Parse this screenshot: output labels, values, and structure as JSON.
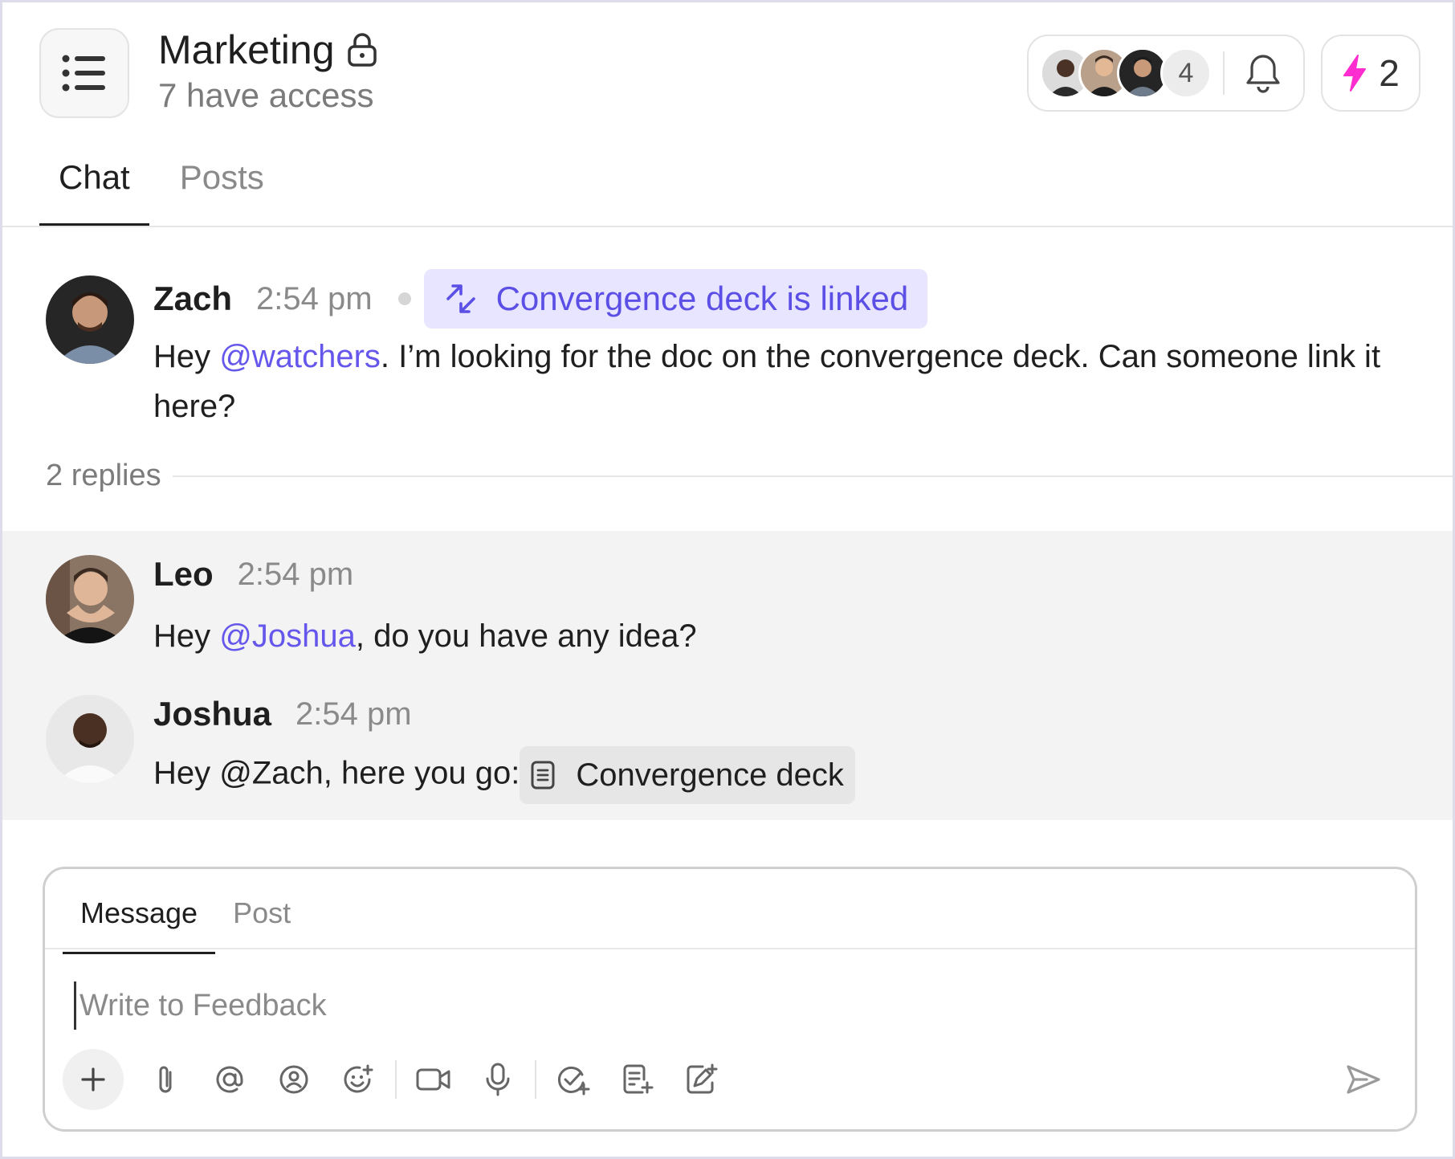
{
  "channel": {
    "title": "Marketing",
    "access_text": "7 have access"
  },
  "header": {
    "watchers_extra_count": "4",
    "boost_count": "2"
  },
  "tabs": [
    {
      "label": "Chat",
      "active": true
    },
    {
      "label": "Posts",
      "active": false
    }
  ],
  "messages": {
    "root": {
      "author": "Zach",
      "time": "2:54 pm",
      "linked_label": "Convergence deck is linked",
      "text_prefix": "Hey ",
      "mention": "@watchers",
      "text_rest": ". I’m looking for the doc on the convergence deck. Can someone link it here?"
    },
    "replies_label": "2 replies",
    "replies": [
      {
        "author": "Leo",
        "time": "2:54 pm",
        "text_prefix": "Hey ",
        "mention": "@Joshua",
        "text_rest": ", do you have any idea?"
      },
      {
        "author": "Joshua",
        "time": "2:54 pm",
        "text": "Hey @Zach, here you go:",
        "doc_label": "Convergence deck"
      }
    ]
  },
  "composer": {
    "tabs": [
      {
        "label": "Message",
        "active": true
      },
      {
        "label": "Post",
        "active": false
      }
    ],
    "placeholder": "Write to Feedback"
  },
  "colors": {
    "accent": "#5b4fe6",
    "mention": "#6657ec",
    "linked_chip_bg": "#e7e5ff",
    "bolt": "#ff2dd0",
    "thread_bg": "#f3f3f3"
  },
  "icons": {
    "menu": "list-icon",
    "lock": "lock-icon",
    "bell": "bell-icon",
    "bolt": "lightning-bolt-icon",
    "link": "link-arrows-icon",
    "doc": "document-icon",
    "toolbar": [
      "plus-icon",
      "attachment-icon",
      "at-mention-icon",
      "contact-mention-icon",
      "emoji-add-icon",
      "video-icon",
      "microphone-icon",
      "task-add-icon",
      "doc-add-icon",
      "whiteboard-add-icon",
      "send-icon"
    ]
  }
}
